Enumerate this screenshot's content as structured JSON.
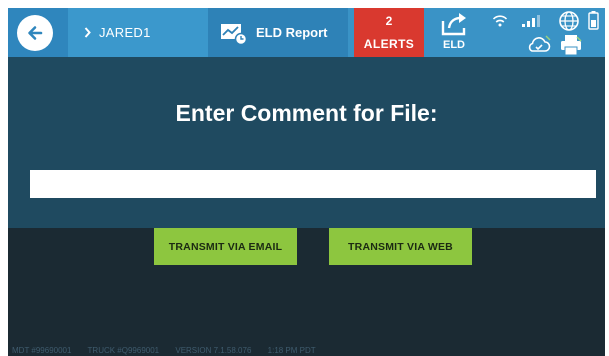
{
  "header": {
    "driver_name": "JARED1",
    "screen_title": "ELD Report",
    "alerts": {
      "count": "2",
      "label": "ALERTS"
    },
    "eld_label": "ELD"
  },
  "main": {
    "prompt": "Enter Comment for File:",
    "comment_value": "",
    "buttons": {
      "email": "TRANSMIT VIA EMAIL",
      "web": "TRANSMIT VIA WEB"
    }
  },
  "footer": {
    "mdt": "MDT #99690001",
    "truck": "TRUCK #Q9969001",
    "version": "VERSION  7.1.58.076",
    "time": "1:18 PM PDT"
  },
  "icons": {
    "back": "back-arrow-icon",
    "driver": "chevron-right-icon",
    "report": "report-icon",
    "eld": "share-icon",
    "wifi": "wifi-icon",
    "signal": "cell-signal-icon",
    "globe": "globe-icon",
    "battery": "battery-icon",
    "cloud": "cloud-sync-icon",
    "printer": "printer-icon"
  },
  "colors": {
    "topbar": "#3a93c6",
    "alerts": "#d9392f",
    "panel": "#1f4a60",
    "background": "#1b2a33",
    "button": "#8dc63f"
  }
}
